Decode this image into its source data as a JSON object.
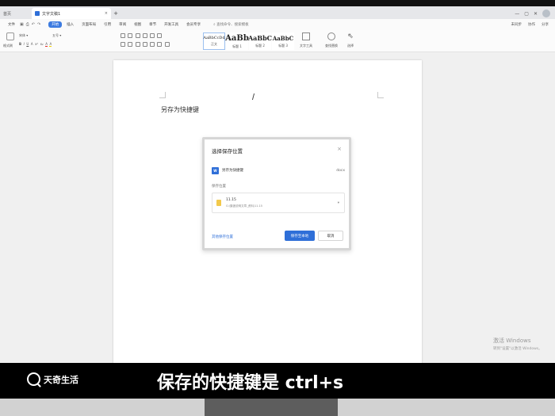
{
  "tabs": {
    "home": "首页",
    "document": "文字文稿1",
    "close": "×",
    "new": "+"
  },
  "window": {
    "status": "未同步",
    "share": "分享"
  },
  "menu": {
    "file": "文件",
    "items": [
      "开始",
      "插入",
      "页面布局",
      "引用",
      "审阅",
      "视图",
      "章节",
      "开发工具",
      "会员专享"
    ],
    "search": "查找命令、搜索模板",
    "right": [
      "未同步",
      "协作",
      "分享"
    ]
  },
  "ribbon": {
    "format_painter": "格式刷",
    "paste": "粘贴",
    "font_name": "宋体",
    "font_size": "五号",
    "styles": [
      {
        "sample": "AaBbCcDd",
        "label": "正文"
      },
      {
        "sample": "AaBb",
        "label": "标题 1"
      },
      {
        "sample": "AaBbC",
        "label": "标题 2"
      },
      {
        "sample": "AaBbC",
        "label": "标题 3"
      }
    ],
    "text_tools": "文字工具",
    "find_replace": "查找替换",
    "select": "选择"
  },
  "document": {
    "text": "另存为快捷键"
  },
  "dialog": {
    "title": "选择保存位置",
    "close": "×",
    "filename": "另存为快捷键",
    "file_icon_label": "W",
    "extension": "docx",
    "location_label": "保存位置",
    "location_name": "11.15",
    "location_path": "G:\\集团说明文章_资料\\11.15",
    "other_location": "其他保存位置",
    "save_button": "保存至本地",
    "cancel_button": "取消"
  },
  "watermark": {
    "line1": "激活 Windows",
    "line2": "转到\"设置\"以激活 Windows。"
  },
  "caption": {
    "logo_text": "天奇生活",
    "text": "保存的快捷键是 ctrl+s"
  }
}
